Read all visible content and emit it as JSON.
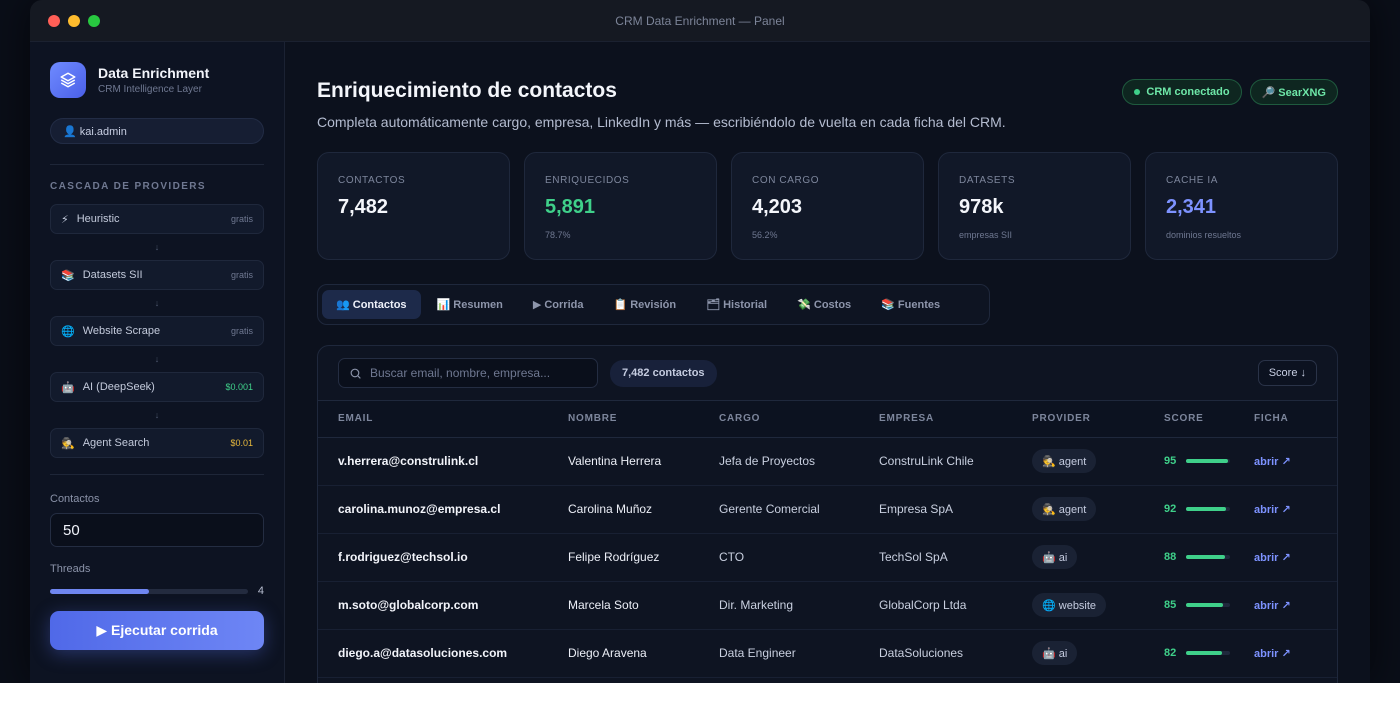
{
  "window": {
    "title": "CRM Data Enrichment — Panel"
  },
  "brand": {
    "name": "Data Enrichment",
    "subtitle": "CRM Intelligence Layer"
  },
  "user": {
    "label": "👤 kai.admin"
  },
  "cascade": {
    "title": "CASCADA DE PROVIDERS",
    "arrow": "↓",
    "providers": [
      {
        "icon": "⚡",
        "label": "Heuristic",
        "cost": "gratis"
      },
      {
        "icon": "📚",
        "label": "Datasets SII",
        "cost": "gratis"
      },
      {
        "icon": "🌐",
        "label": "Website Scrape",
        "cost": "gratis"
      },
      {
        "icon": "🤖",
        "label": "AI (DeepSeek)",
        "cost": "$0.001"
      },
      {
        "icon": "🕵",
        "label": "Agent Search",
        "cost": "$0.01"
      }
    ]
  },
  "controls": {
    "contactos_label": "Contactos",
    "contactos_value": "50",
    "threads_label": "Threads",
    "threads_value": "4",
    "threads_fraction": 0.5,
    "run_label": "▶ Ejecutar corrida"
  },
  "header": {
    "title": "Enriquecimiento de contactos",
    "subtitle": "Completa automáticamente cargo, empresa, LinkedIn y más — escribiéndolo de vuelta en cada ficha del CRM.",
    "crm_status": "CRM conectado",
    "searx": "🔎 SearXNG"
  },
  "stats": [
    {
      "label": "CONTACTOS",
      "value": "7,482",
      "note": ""
    },
    {
      "label": "ENRIQUECIDOS",
      "value": "5,891",
      "note": "78.7%"
    },
    {
      "label": "CON CARGO",
      "value": "4,203",
      "note": "56.2%"
    },
    {
      "label": "DATASETS",
      "value": "978k",
      "note": "empresas SII"
    },
    {
      "label": "CACHE IA",
      "value": "2,341",
      "note": "dominios resueltos"
    }
  ],
  "tabs": [
    "👥 Contactos",
    "📊 Resumen",
    "▶ Corrida",
    "📋 Revisión",
    "🗂 Historial",
    "💸 Costos",
    "📚 Fuentes"
  ],
  "toolbar": {
    "search_placeholder": "Buscar email, nombre, empresa...",
    "count": "7,482 contactos",
    "sort": "Score ↓"
  },
  "table": {
    "columns": [
      "EMAIL",
      "NOMBRE",
      "CARGO",
      "EMPRESA",
      "PROVIDER",
      "SCORE",
      "FICHA"
    ],
    "rows": [
      {
        "email": "v.herrera@construlink.cl",
        "nombre": "Valentina Herrera",
        "cargo": "Jefa de Proyectos",
        "empresa": "ConstruLink Chile",
        "provider": "🕵 agent",
        "score": "95",
        "score_value": 95,
        "ficha": "abrir ↗"
      },
      {
        "email": "carolina.munoz@empresa.cl",
        "nombre": "Carolina Muñoz",
        "cargo": "Gerente Comercial",
        "empresa": "Empresa SpA",
        "provider": "🕵 agent",
        "score": "92",
        "score_value": 92,
        "ficha": "abrir ↗"
      },
      {
        "email": "f.rodriguez@techsol.io",
        "nombre": "Felipe Rodríguez",
        "cargo": "CTO",
        "empresa": "TechSol SpA",
        "provider": "🤖 ai",
        "score": "88",
        "score_value": 88,
        "ficha": "abrir ↗"
      },
      {
        "email": "m.soto@globalcorp.com",
        "nombre": "Marcela Soto",
        "cargo": "Dir. Marketing",
        "empresa": "GlobalCorp Ltda",
        "provider": "🌐 website",
        "score": "85",
        "score_value": 85,
        "ficha": "abrir ↗"
      },
      {
        "email": "diego.a@datasoluciones.com",
        "nombre": "Diego Aravena",
        "cargo": "Data Engineer",
        "empresa": "DataSoluciones",
        "provider": "🤖 ai",
        "score": "82",
        "score_value": 82,
        "ficha": "abrir ↗"
      }
    ]
  }
}
